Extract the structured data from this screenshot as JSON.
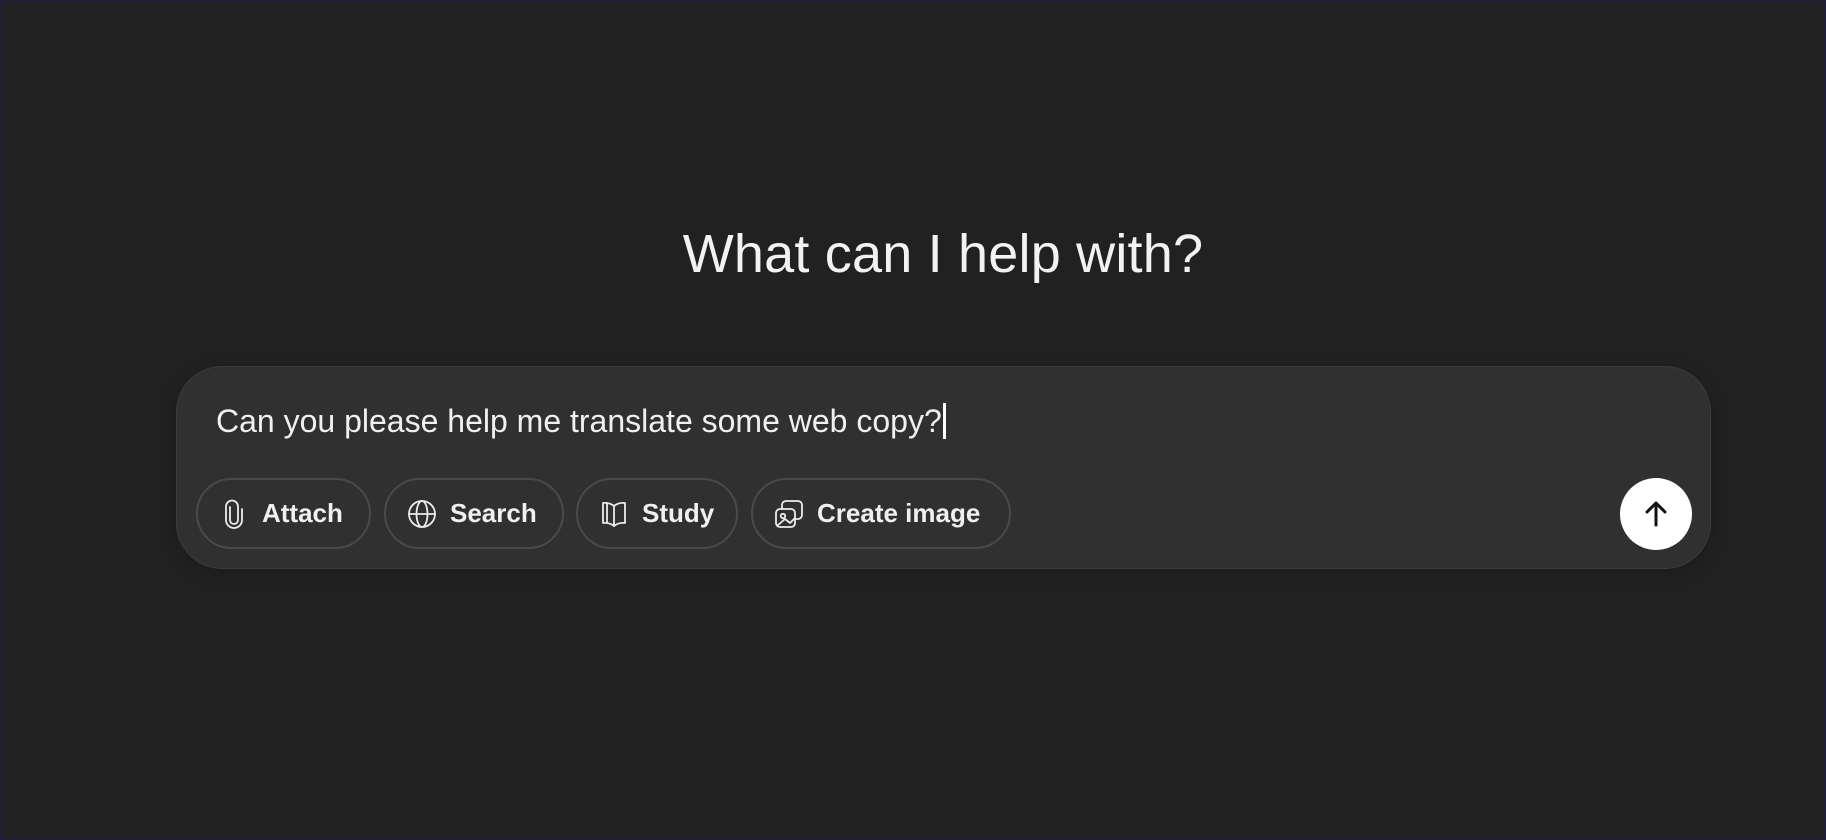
{
  "heading": "What can I help with?",
  "composer": {
    "input_value": "Can you please help me translate some web copy?"
  },
  "tools": {
    "attach_label": "Attach",
    "search_label": "Search",
    "study_label": "Study",
    "create_image_label": "Create image"
  },
  "icons": {
    "attach": "paperclip-icon",
    "search": "globe-icon",
    "study": "book-icon",
    "create_image": "images-icon",
    "send": "arrow-up-icon"
  },
  "colors": {
    "background": "#212121",
    "composer_bg": "#303030",
    "send_button_bg": "#ffffff"
  }
}
